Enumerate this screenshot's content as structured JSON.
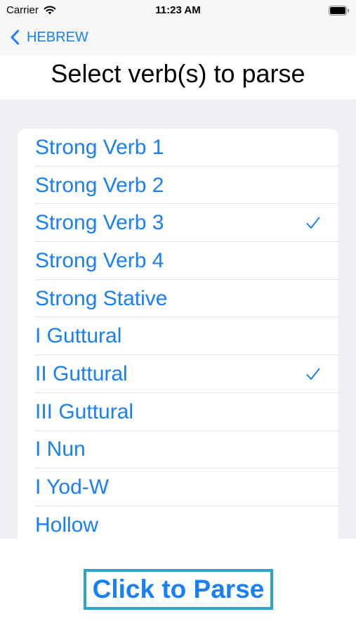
{
  "status_bar": {
    "carrier": "Carrier",
    "time": "11:23 AM",
    "wifi_icon": "wifi-icon",
    "battery_icon": "battery-icon"
  },
  "nav": {
    "back_label": "HEBREW",
    "back_icon": "chevron-left-icon"
  },
  "title": "Select verb(s) to parse",
  "verbs": [
    {
      "label": "Strong Verb 1",
      "checked": false
    },
    {
      "label": "Strong Verb 2",
      "checked": false
    },
    {
      "label": "Strong Verb 3",
      "checked": true
    },
    {
      "label": "Strong Verb 4",
      "checked": false
    },
    {
      "label": "Strong Stative",
      "checked": false
    },
    {
      "label": "I Guttural",
      "checked": false
    },
    {
      "label": "II Guttural",
      "checked": true
    },
    {
      "label": "III Guttural",
      "checked": false
    },
    {
      "label": "I Nun",
      "checked": false
    },
    {
      "label": "I Yod-W",
      "checked": false
    },
    {
      "label": "Hollow",
      "checked": false
    },
    {
      "label": "",
      "checked": false
    }
  ],
  "parse_button": "Click to Parse",
  "colors": {
    "accent": "#1a7ef7",
    "button_border": "#2aa6c4",
    "grouped_background": "#efeff4"
  }
}
